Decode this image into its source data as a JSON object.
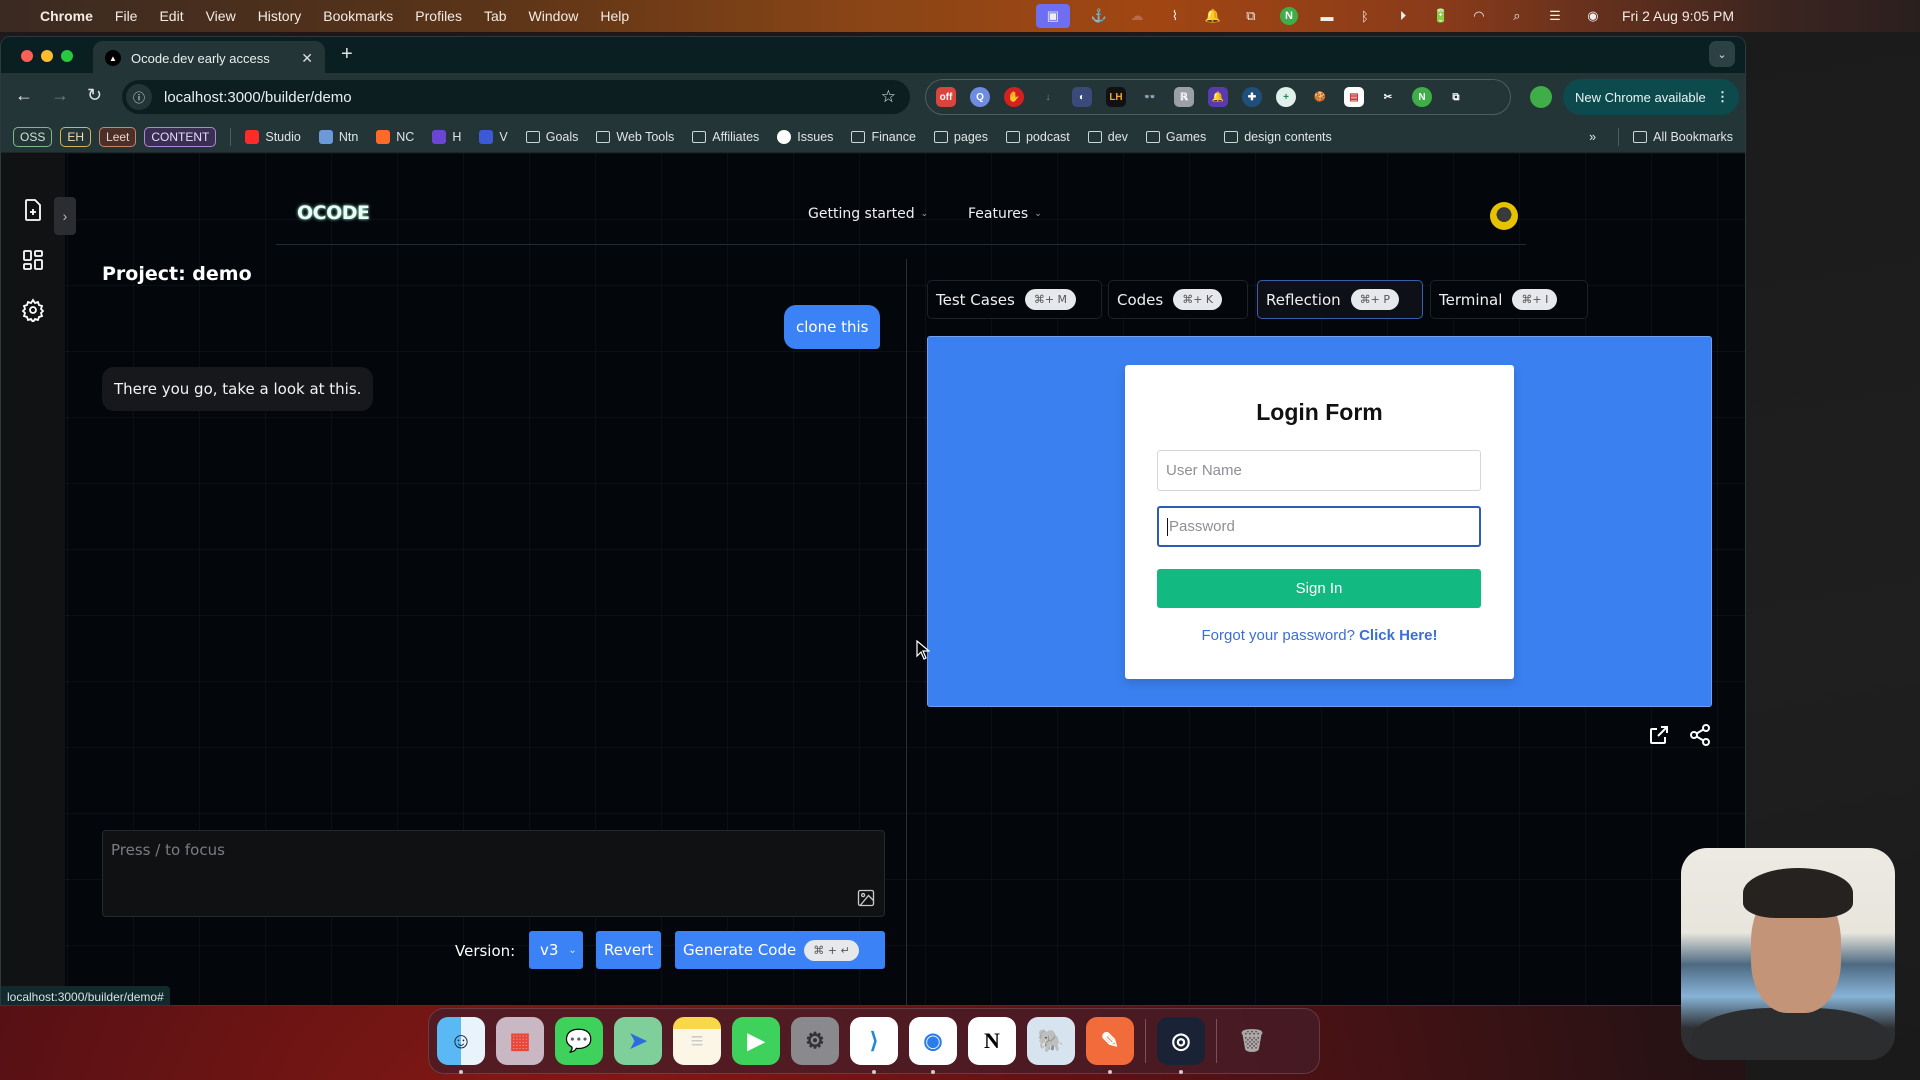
{
  "menubar": {
    "app_name": "Chrome",
    "menus": [
      "File",
      "Edit",
      "View",
      "History",
      "Bookmarks",
      "Profiles",
      "Tab",
      "Window",
      "Help"
    ],
    "status_icons": [
      "screen-share-icon",
      "docker-icon",
      "cloud-icon",
      "paperclip-icon",
      "bell-icon",
      "window-icon",
      "n-app-icon",
      "menu-icon",
      "bluetooth-off-icon",
      "play-icon",
      "battery-charging-icon",
      "wifi-icon",
      "spotlight-icon",
      "control-center-icon",
      "siri-icon"
    ],
    "datetime": "Fri 2 Aug  9:05 PM"
  },
  "browser": {
    "tab_title": "Ocode.dev early access",
    "tab_close": "✕",
    "new_tab": "+",
    "url": "localhost:3000/builder/demo",
    "new_chrome_label": "New Chrome available",
    "extensions": [
      "off",
      "Q",
      "✋",
      "↓",
      "◐",
      "LH",
      "👓",
      "ℝ",
      "🔔",
      "✚",
      "+",
      "🍪",
      "▤",
      "✂",
      "N",
      "⧉"
    ],
    "bookmark_pills": [
      {
        "label": "OSS",
        "color": "#7fb98a"
      },
      {
        "label": "EH",
        "color": "#d6b35b"
      },
      {
        "label": "Leet",
        "color": "#c7856a"
      },
      {
        "label": "CONTENT",
        "color": "#a98ad8"
      }
    ],
    "bookmarks": [
      {
        "label": "Studio",
        "icon": "youtube-icon",
        "color": "#ff2a2a"
      },
      {
        "label": "Ntn",
        "icon": "ntn-icon",
        "color": "#6a9bd8"
      },
      {
        "label": "NC",
        "icon": "nc-icon",
        "color": "#ff6a2a"
      },
      {
        "label": "H",
        "icon": "h-icon",
        "color": "#6b46d6"
      },
      {
        "label": "V",
        "icon": "v-icon",
        "color": "#3b5bd6"
      },
      {
        "label": "Goals",
        "icon": "folder-icon"
      },
      {
        "label": "Web Tools",
        "icon": "folder-icon"
      },
      {
        "label": "Affiliates",
        "icon": "folder-icon"
      },
      {
        "label": "Issues",
        "icon": "github-icon"
      },
      {
        "label": "Finance",
        "icon": "folder-icon"
      },
      {
        "label": "pages",
        "icon": "folder-icon"
      },
      {
        "label": "podcast",
        "icon": "folder-icon"
      },
      {
        "label": "dev",
        "icon": "folder-icon"
      },
      {
        "label": "Games",
        "icon": "folder-icon"
      },
      {
        "label": "design contents",
        "icon": "folder-icon"
      }
    ],
    "more_bookmarks": "»",
    "all_bookmarks": "All Bookmarks",
    "status_url": "localhost:3000/builder/demo#"
  },
  "app": {
    "logo": "OCODE",
    "nav": [
      "Getting started",
      "Features"
    ],
    "project_title": "Project: demo",
    "chat": [
      {
        "role": "user",
        "text": "clone this"
      },
      {
        "role": "assistant",
        "text": "There you go, take a look at this."
      }
    ],
    "prompt_placeholder": "Press / to focus",
    "version_label": "Version:",
    "version_value": "v3",
    "revert_label": "Revert",
    "generate_label": "Generate Code",
    "generate_shortcut": "⌘ + ↵",
    "tabs": [
      {
        "label": "Test Cases",
        "shortcut": "⌘+ M",
        "active": false
      },
      {
        "label": "Codes",
        "shortcut": "⌘+ K",
        "active": false
      },
      {
        "label": "Reflection",
        "shortcut": "⌘+ P",
        "active": true
      },
      {
        "label": "Terminal",
        "shortcut": "⌘+ I",
        "active": false
      }
    ],
    "preview": {
      "background": "#3b80f0",
      "title": "Login Form",
      "username_placeholder": "User Name",
      "password_placeholder": "Password",
      "signin_label": "Sign In",
      "signin_color": "#12b981",
      "forgot_text": "Forgot your password?",
      "forgot_link": "Click Here!"
    }
  },
  "dock": {
    "apps": [
      {
        "name": "Finder",
        "glyph": "☺",
        "bg": "#3aa0f5",
        "running": true
      },
      {
        "name": "Launchpad",
        "glyph": "▦",
        "bg": "#c9b7c4",
        "running": false
      },
      {
        "name": "Messages",
        "glyph": "💬",
        "bg": "#3ed15b",
        "running": false
      },
      {
        "name": "Maps",
        "glyph": "➤",
        "bg": "#7fcf9b",
        "running": false
      },
      {
        "name": "Notes",
        "glyph": "≡",
        "bg": "#f8e17a",
        "running": false
      },
      {
        "name": "FaceTime",
        "glyph": "▶",
        "bg": "#3ed15b",
        "running": false
      },
      {
        "name": "System Settings",
        "glyph": "⚙",
        "bg": "#8a8a8e",
        "running": false
      },
      {
        "name": "VS Code",
        "glyph": "⟩",
        "bg": "#ffffff",
        "running": true
      },
      {
        "name": "Chrome",
        "glyph": "◉",
        "bg": "#ffffff",
        "running": true
      },
      {
        "name": "Notion",
        "glyph": "N",
        "bg": "#ffffff",
        "running": false
      },
      {
        "name": "pgAdmin",
        "glyph": "🐘",
        "bg": "#d7e3ee",
        "running": false
      },
      {
        "name": "Postman",
        "glyph": "✎",
        "bg": "#f26b3a",
        "running": true
      },
      {
        "name": "OBS",
        "glyph": "◎",
        "bg": "#1a2236",
        "running": true
      },
      {
        "name": "Trash",
        "glyph": "🗑",
        "bg": "#9a9a9a",
        "running": false
      }
    ]
  }
}
